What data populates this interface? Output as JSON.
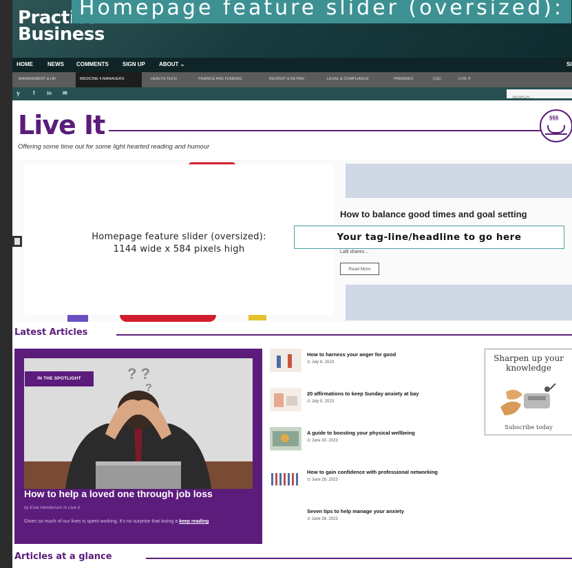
{
  "site": {
    "logo_line1": "Practice",
    "logo_line2": "Business"
  },
  "banner_text": "Homepage feature slider (oversized):",
  "nav_main": [
    "HOME",
    "NEWS",
    "COMMENTS",
    "SIGN UP",
    "ABOUT ⌄",
    "SI"
  ],
  "nav_sub": [
    "MANAGEMENT & HR",
    "MEDICINE 4 MANAGERS",
    "HEALTH TECH",
    "FINANCE AND FUNDING",
    "RECRUIT & RETAIN",
    "LEGAL & COMPLIANCE",
    "PREMISES",
    "CQC",
    "LIVE IT"
  ],
  "social": [
    "𝕪",
    "f",
    "in",
    "✉"
  ],
  "search_placeholder": "SEARCH...",
  "section": {
    "title": "Live It",
    "subtitle": "Offering some time out for some light hearted reading and humour",
    "steam": "§§§"
  },
  "slider": {
    "placeholder_line1": "Homepage feature slider (oversized):",
    "placeholder_line2": "1144 wide x 584 pixels high",
    "headline": "Your tag-line/headline to go here",
    "article_title": "How to balance good times and goal setting",
    "snippet": "Lalli shares...",
    "read_more": "Read More"
  },
  "latest": {
    "title": "Latest Articles",
    "badge": "IN THE SPOTLIGHT",
    "feature_title": "How to help a loved one through job loss",
    "feature_by": "by Esta Henderson in Live it",
    "feature_excerpt": "Given so much of our lives is spent working, it's no surprise that losing a",
    "feature_link": "keep reading",
    "articles": [
      {
        "title": "How to harness your anger for good",
        "date": "⊙ July 6, 2023"
      },
      {
        "title": "20 affirmations to keep Sunday anxiety at bay",
        "date": "⊙ July 5, 2023"
      },
      {
        "title": "A guide to boosting your physical wellbeing",
        "date": "⊙ June 30, 2023"
      },
      {
        "title": "How to gain confidence with professional networking",
        "date": "⊙ June 29, 2023"
      },
      {
        "title": "Seven tips to help manage your anxiety",
        "date": "⊙ June 28, 2023"
      }
    ]
  },
  "ad": {
    "headline": "Sharpen up your knowledge",
    "cta": "Subscribe today"
  },
  "glance": {
    "title": "Articles at a glance"
  },
  "colors": {
    "purple": "#5b1c7b",
    "teal": "#3e9193",
    "header_dark": "#183c3e"
  }
}
